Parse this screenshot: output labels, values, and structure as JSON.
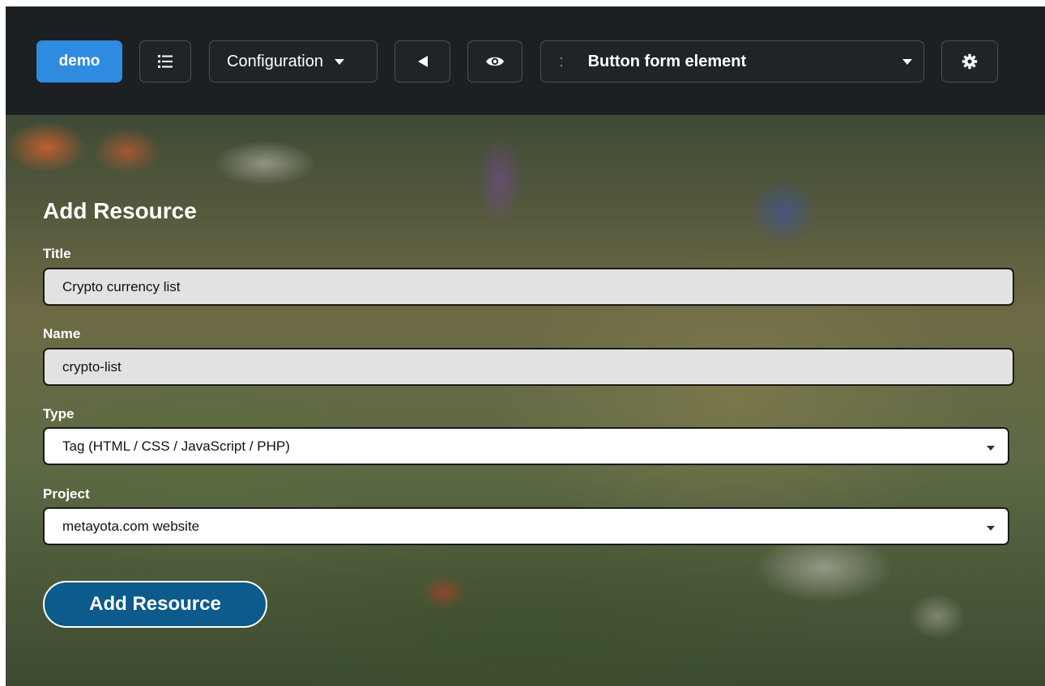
{
  "toolbar": {
    "demo_label": "demo",
    "config_label": "Configuration",
    "page_separator": ":",
    "page_title": "Button form element"
  },
  "form": {
    "title": "Add Resource",
    "fields": {
      "title": {
        "label": "Title",
        "value": "Crypto currency list"
      },
      "name": {
        "label": "Name",
        "value": "crypto-list"
      },
      "type": {
        "label": "Type",
        "value": "Tag (HTML / CSS / JavaScript / PHP)"
      },
      "project": {
        "label": "Project",
        "value": "metayota.com website"
      }
    },
    "submit_label": "Add Resource"
  },
  "colors": {
    "toolbar_bg": "#1c2023",
    "demo_accent": "#2f8be0",
    "submit_bg": "#0d5a8c"
  },
  "icons": {
    "list": "list-icon",
    "back": "triangle-left-icon",
    "view": "eye-icon",
    "settings": "gear-icon",
    "dropdown": "chevron-down-icon"
  }
}
